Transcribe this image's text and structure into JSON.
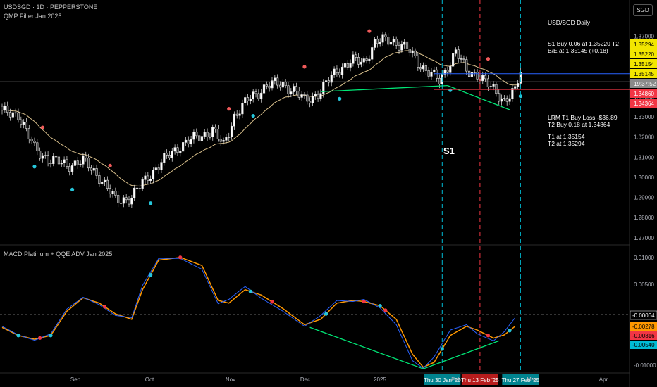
{
  "header": {
    "symbol_line": "USDSGD · 1D · PEPPERSTONE",
    "indicator_line": "QMP Filter Jan 2025",
    "macd_title": "MACD Platinum + QQE ADV Jan 2025"
  },
  "currency_button": "SGD",
  "notes": {
    "title": "USD/SGD Daily",
    "s1": "S1 Buy 0.06 at 1.35220 T2",
    "be": "B/E at 1.35145 (+0.18)",
    "lrm": "LRM T1 Buy Loss -$36.89",
    "t2buy": "T2 Buy 0.18 at 1.34864",
    "t1": "T1 at 1.35154",
    "t2": "T2 at 1.35294",
    "s1_marker": "S1"
  },
  "chart_data": [
    {
      "type": "candlestick",
      "title": "USDSGD · 1D · PEPPERSTONE",
      "ylim": [
        1.2675,
        1.3775
      ],
      "x_ticks": [
        "Sep",
        "Oct",
        "Nov",
        "Dec",
        "2025",
        "Feb",
        "Mar",
        "Apr"
      ],
      "y_ticks": [
        "1.37000",
        "1.36000",
        "1.34000",
        "1.33000",
        "1.32000",
        "1.31000",
        "1.30000",
        "1.29000",
        "1.28000",
        "1.27000"
      ],
      "price_labels": [
        {
          "value": 1.35294,
          "text": "1.35294",
          "color": "#f2e600"
        },
        {
          "value": 1.3522,
          "text": "1.35220",
          "color": "#f2e600"
        },
        {
          "value": 1.35154,
          "text": "1.35154",
          "color": "#f2e600"
        },
        {
          "value": 1.35145,
          "text": "1.35145",
          "color": "#f2e600"
        },
        {
          "value": 1.3474,
          "text": "19:37:52",
          "color": "#8a8a8a"
        },
        {
          "value": 1.3486,
          "text": "1.34860",
          "color": "#f23645"
        },
        {
          "value": 1.34364,
          "text": "1.34364",
          "color": "#f23645"
        }
      ],
      "levels": [
        {
          "value": 1.3522,
          "color": "#f2e600",
          "style": "dash"
        },
        {
          "value": 1.3514,
          "color": "#2962ff",
          "style": "solid"
        },
        {
          "value": 1.3475,
          "color": "#aaaaaa",
          "style": "solid"
        },
        {
          "value": 1.3436,
          "color": "#f23645",
          "style": "solid"
        }
      ],
      "vertical_markers": [
        {
          "label": "Thu 30 Jan '25",
          "color": "#00bcd4"
        },
        {
          "label": "Thu 13 Feb '25",
          "color": "#f23645"
        },
        {
          "label": "Thu 27 Feb '25",
          "color": "#00bcd4"
        }
      ],
      "close_anchors": [
        [
          0,
          1.332
        ],
        [
          6,
          1.3315
        ],
        [
          12,
          1.314
        ],
        [
          18,
          1.3085
        ],
        [
          24,
          1.306
        ],
        [
          30,
          1.308
        ],
        [
          36,
          1.3005
        ],
        [
          42,
          1.2885
        ],
        [
          48,
          1.29
        ],
        [
          54,
          1.3005
        ],
        [
          60,
          1.3085
        ],
        [
          66,
          1.316
        ],
        [
          72,
          1.3195
        ],
        [
          78,
          1.3235
        ],
        [
          82,
          1.3155
        ],
        [
          86,
          1.3305
        ],
        [
          92,
          1.3395
        ],
        [
          98,
          1.3455
        ],
        [
          104,
          1.3465
        ],
        [
          108,
          1.343
        ],
        [
          112,
          1.338
        ],
        [
          118,
          1.3425
        ],
        [
          124,
          1.3535
        ],
        [
          130,
          1.3575
        ],
        [
          134,
          1.3575
        ],
        [
          138,
          1.3665
        ],
        [
          144,
          1.3685
        ],
        [
          150,
          1.3635
        ],
        [
          156,
          1.3545
        ],
        [
          162,
          1.3475
        ],
        [
          168,
          1.3625
        ],
        [
          172,
          1.3525
        ],
        [
          176,
          1.3515
        ],
        [
          180,
          1.3455
        ],
        [
          186,
          1.3385
        ],
        [
          190,
          1.3425
        ],
        [
          192,
          1.3522
        ]
      ],
      "moving_average": "slow smoothed average of closes"
    },
    {
      "type": "line",
      "title": "MACD Platinum + QQE ADV Jan 2025",
      "ylim": [
        -0.0112,
        0.0118
      ],
      "y_ticks": [
        "0.01000",
        "0.00500",
        "-0.01000"
      ],
      "value_labels": [
        {
          "value": -0.00064,
          "text": "-0.00064",
          "color": "#ffffff"
        },
        {
          "value": -0.00278,
          "text": "-0.00278",
          "color": "#ff9800"
        },
        {
          "value": -0.00316,
          "text": "-0.00316",
          "color": "#f23645"
        },
        {
          "value": -0.0054,
          "text": "-0.00540",
          "color": "#00bcd4"
        }
      ],
      "zero_line": -0.00064,
      "series": [
        {
          "name": "",
          "color": "#ff9800",
          "anchors": [
            [
              0,
              -0.003
            ],
            [
              6,
              -0.0045
            ],
            [
              12,
              -0.0052
            ],
            [
              18,
              -0.0045
            ],
            [
              24,
              0
            ],
            [
              30,
              0.0025
            ],
            [
              36,
              0.0015
            ],
            [
              42,
              -0.0005
            ],
            [
              48,
              -0.0015
            ],
            [
              52,
              0.004
            ],
            [
              58,
              0.0095
            ],
            [
              66,
              0.01
            ],
            [
              74,
              0.0085
            ],
            [
              80,
              0.002
            ],
            [
              84,
              0.0015
            ],
            [
              90,
              0.004
            ],
            [
              96,
              0.003
            ],
            [
              104,
              0.0005
            ],
            [
              112,
              -0.0025
            ],
            [
              118,
              -0.0015
            ],
            [
              124,
              0.0015
            ],
            [
              130,
              0.002
            ],
            [
              134,
              0.0018
            ],
            [
              140,
              0.001
            ],
            [
              146,
              -0.0015
            ],
            [
              152,
              -0.008
            ],
            [
              156,
              -0.0104
            ],
            [
              160,
              -0.0095
            ],
            [
              166,
              -0.0045
            ],
            [
              172,
              -0.0028
            ],
            [
              176,
              -0.0035
            ],
            [
              182,
              -0.005
            ],
            [
              186,
              -0.0044
            ],
            [
              190,
              -0.0028
            ]
          ]
        },
        {
          "name": "",
          "color": "#2962ff",
          "anchors": [
            [
              0,
              -0.0028
            ],
            [
              6,
              -0.0044
            ],
            [
              12,
              -0.0054
            ],
            [
              18,
              -0.0042
            ],
            [
              24,
              0.0004
            ],
            [
              30,
              0.0026
            ],
            [
              36,
              0.0012
            ],
            [
              42,
              -0.0008
            ],
            [
              48,
              -0.0012
            ],
            [
              52,
              0.0048
            ],
            [
              58,
              0.0098
            ],
            [
              66,
              0.0098
            ],
            [
              74,
              0.0078
            ],
            [
              80,
              0.0014
            ],
            [
              84,
              0.0022
            ],
            [
              90,
              0.0046
            ],
            [
              96,
              0.0024
            ],
            [
              104,
              0
            ],
            [
              112,
              -0.0028
            ],
            [
              118,
              -0.0008
            ],
            [
              124,
              0.002
            ],
            [
              130,
              0.0018
            ],
            [
              134,
              0.0022
            ],
            [
              140,
              0.0006
            ],
            [
              146,
              -0.0025
            ],
            [
              152,
              -0.0092
            ],
            [
              156,
              -0.0106
            ],
            [
              160,
              -0.0085
            ],
            [
              166,
              -0.0035
            ],
            [
              172,
              -0.0025
            ],
            [
              176,
              -0.0042
            ],
            [
              182,
              -0.0055
            ],
            [
              186,
              -0.0038
            ],
            [
              190,
              -0.0012
            ]
          ]
        }
      ],
      "divergence_line": {
        "from": [
          114,
          -0.003
        ],
        "to": [
          156,
          -0.0107
        ]
      },
      "divergence_line_2": {
        "from": [
          156,
          -0.0107
        ],
        "to": [
          184,
          -0.0055
        ]
      }
    }
  ]
}
